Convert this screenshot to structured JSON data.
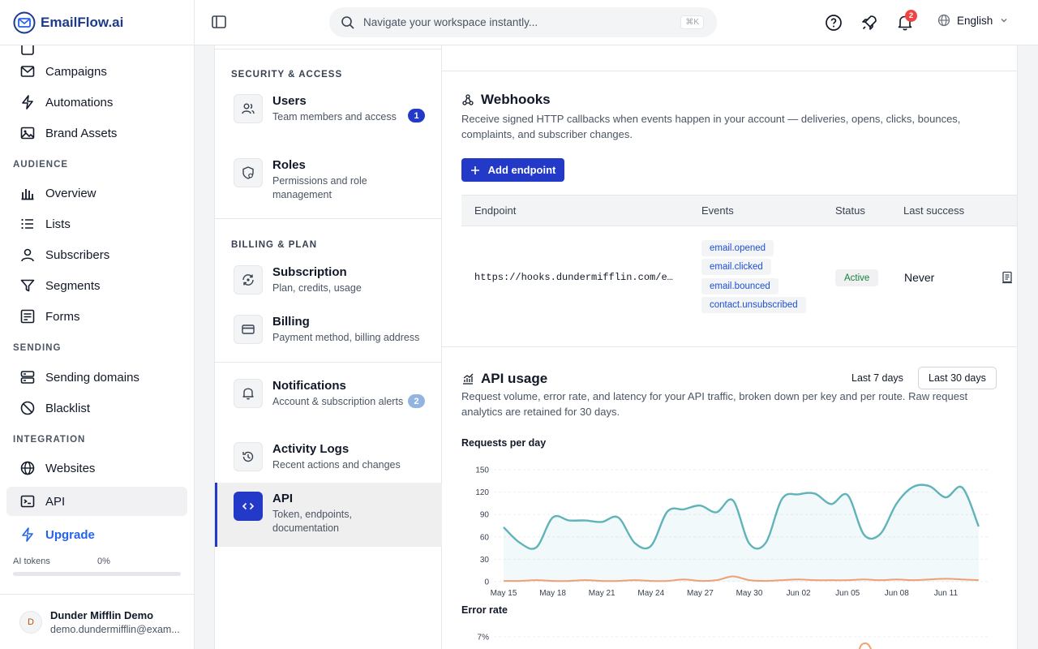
{
  "app": {
    "brand": "EmailFlow.ai"
  },
  "sidebar": {
    "items": [
      {
        "label": "Campaigns",
        "icon": "mail-icon"
      },
      {
        "label": "Automations",
        "icon": "bolt-icon"
      },
      {
        "label": "Brand Assets",
        "icon": "image-icon"
      }
    ],
    "sections": [
      {
        "title": "AUDIENCE",
        "items": [
          {
            "label": "Overview",
            "icon": "bar-chart-icon"
          },
          {
            "label": "Lists",
            "icon": "list-icon"
          },
          {
            "label": "Subscribers",
            "icon": "user-icon"
          },
          {
            "label": "Segments",
            "icon": "funnel-icon"
          },
          {
            "label": "Forms",
            "icon": "form-icon"
          }
        ]
      },
      {
        "title": "SENDING",
        "items": [
          {
            "label": "Sending domains",
            "icon": "server-icon"
          },
          {
            "label": "Blacklist",
            "icon": "ban-icon"
          }
        ]
      },
      {
        "title": "INTEGRATION",
        "items": [
          {
            "label": "Websites",
            "icon": "globe-icon"
          },
          {
            "label": "API",
            "icon": "terminal-icon",
            "active": true
          }
        ]
      }
    ],
    "upgrade_label": "Upgrade",
    "ai_tokens_label": "AI tokens",
    "ai_tokens_pct": "0%",
    "ai_tokens_fraction": 0,
    "user": {
      "initial": "D",
      "name": "Dunder Mifflin Demo",
      "email": "demo.dundermifflin@exam..."
    }
  },
  "topbar": {
    "search_placeholder": "Navigate your workspace instantly...",
    "search_shortcut": "⌘K",
    "notification_count": "2",
    "language": "English"
  },
  "settings_menu": {
    "sections": [
      {
        "title": "SECURITY & ACCESS",
        "items": [
          {
            "title": "Users",
            "desc": "Team members and access",
            "badge": "1",
            "icon": "users-icon"
          },
          {
            "title": "Roles",
            "desc": "Permissions and role management",
            "icon": "shield-icon"
          }
        ]
      },
      {
        "title": "BILLING & PLAN",
        "items": [
          {
            "title": "Subscription",
            "desc": "Plan, credits, usage",
            "icon": "refresh-icon"
          },
          {
            "title": "Billing",
            "desc": "Payment method, billing address",
            "icon": "credit-card-icon"
          }
        ]
      },
      {
        "title": "",
        "items": [
          {
            "title": "Notifications",
            "desc": "Account & subscription alerts",
            "badge": "2",
            "icon": "bell-icon"
          },
          {
            "title": "Activity Logs",
            "desc": "Recent actions and changes",
            "icon": "history-icon"
          },
          {
            "title": "API",
            "desc": "Token, endpoints, documentation",
            "icon": "code-icon",
            "active": true
          }
        ]
      }
    ]
  },
  "webhooks": {
    "title": "Webhooks",
    "desc": "Receive signed HTTP callbacks when events happen in your account — deliveries, opens, clicks, bounces, complaints, and subscriber changes.",
    "add_button": "Add endpoint",
    "columns": [
      "Endpoint",
      "Events",
      "Status",
      "Last success"
    ],
    "rows": [
      {
        "endpoint": "https://hooks.dundermifflin.com/e…",
        "events": [
          "email.opened",
          "email.clicked",
          "email.bounced",
          "contact.unsubscribed"
        ],
        "status": "Active",
        "last_success": "Never"
      }
    ]
  },
  "api_usage": {
    "title": "API usage",
    "desc": "Request volume, error rate, and latency for your API traffic, broken down per key and per route. Raw request analytics are retained for 30 days.",
    "ranges": [
      "Last 7 days",
      "Last 30 days"
    ],
    "selected_range": "Last 30 days",
    "requests_label": "Requests per day",
    "error_label": "Error rate",
    "error_top_tick": "7%"
  },
  "chart_data": [
    {
      "type": "area",
      "title": "Requests per day",
      "x_tick_labels": [
        "May 15",
        "May 18",
        "May 21",
        "May 24",
        "May 27",
        "May 30",
        "Jun 02",
        "Jun 05",
        "Jun 08",
        "Jun 11"
      ],
      "y_tick_labels": [
        "0",
        "30",
        "60",
        "90",
        "120",
        "150"
      ],
      "ylim": [
        0,
        150
      ],
      "grid": true,
      "colors": {
        "requests": "#5fb3b9",
        "errors": "#f0a070"
      },
      "x": [
        "May 15",
        "May 16",
        "May 17",
        "May 18",
        "May 19",
        "May 20",
        "May 21",
        "May 22",
        "May 23",
        "May 24",
        "May 25",
        "May 26",
        "May 27",
        "May 28",
        "May 29",
        "May 30",
        "May 31",
        "Jun 01",
        "Jun 02",
        "Jun 03",
        "Jun 04",
        "Jun 05",
        "Jun 06",
        "Jun 07",
        "Jun 08",
        "Jun 09",
        "Jun 10",
        "Jun 11",
        "Jun 12",
        "Jun 13"
      ],
      "series": [
        {
          "values": [
            73,
            52,
            46,
            86,
            82,
            82,
            80,
            86,
            52,
            48,
            94,
            97,
            102,
            93,
            109,
            51,
            52,
            111,
            117,
            118,
            104,
            116,
            63,
            64,
            105,
            127,
            128,
            113,
            126,
            74
          ]
        },
        {
          "values": [
            1,
            1,
            2,
            1,
            1,
            2,
            1,
            1,
            2,
            1,
            1,
            3,
            1,
            2,
            7,
            2,
            1,
            2,
            3,
            2,
            2,
            2,
            3,
            2,
            3,
            2,
            3,
            4,
            3,
            2
          ]
        }
      ]
    },
    {
      "type": "line",
      "title": "Error rate",
      "y_tick_labels": [
        "7%"
      ],
      "colors": {
        "errors": "#f0a070"
      }
    }
  ]
}
